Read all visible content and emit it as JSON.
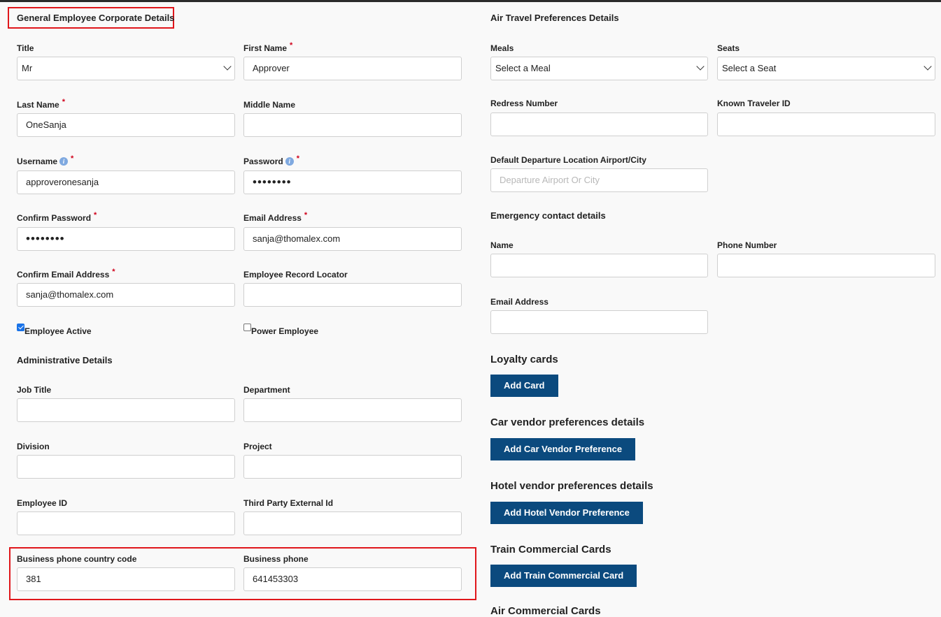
{
  "left": {
    "section_title": "General Employee Corporate Details",
    "title": {
      "label": "Title",
      "value": "Mr"
    },
    "first_name": {
      "label": "First Name",
      "value": "Approver"
    },
    "last_name": {
      "label": "Last Name",
      "value": "OneSanja"
    },
    "middle_name": {
      "label": "Middle Name",
      "value": ""
    },
    "username": {
      "label": "Username",
      "value": "approveronesanja"
    },
    "password": {
      "label": "Password",
      "value": "••••••••"
    },
    "confirm_password": {
      "label": "Confirm Password",
      "value": "••••••••"
    },
    "email": {
      "label": "Email Address",
      "value": "sanja@thomalex.com"
    },
    "confirm_email": {
      "label": "Confirm Email Address",
      "value": "sanja@thomalex.com"
    },
    "employee_record_locator": {
      "label": "Employee Record Locator",
      "value": ""
    },
    "employee_active": {
      "label": "Employee Active",
      "checked": true
    },
    "power_employee": {
      "label": "Power Employee",
      "checked": false
    },
    "admin_title": "Administrative Details",
    "job_title": {
      "label": "Job Title",
      "value": ""
    },
    "department": {
      "label": "Department",
      "value": ""
    },
    "division": {
      "label": "Division",
      "value": ""
    },
    "project": {
      "label": "Project",
      "value": ""
    },
    "employee_id": {
      "label": "Employee ID",
      "value": ""
    },
    "third_party_id": {
      "label": "Third Party External Id",
      "value": ""
    },
    "business_phone_cc": {
      "label": "Business phone country code",
      "value": "381"
    },
    "business_phone": {
      "label": "Business phone",
      "value": "641453303"
    },
    "required_mark": "*"
  },
  "right": {
    "section_title": "Air Travel Preferences Details",
    "meals": {
      "label": "Meals",
      "value": "Select a Meal"
    },
    "seats": {
      "label": "Seats",
      "value": "Select a Seat"
    },
    "redress": {
      "label": "Redress Number",
      "value": ""
    },
    "known_traveler": {
      "label": "Known Traveler ID",
      "value": ""
    },
    "departure": {
      "label": "Default Departure Location Airport/City",
      "placeholder": "Departure Airport Or City"
    },
    "emergency_title": "Emergency contact details",
    "em_name": {
      "label": "Name",
      "value": ""
    },
    "em_phone": {
      "label": "Phone Number",
      "value": ""
    },
    "em_email": {
      "label": "Email Address",
      "value": ""
    },
    "loyalty_title": "Loyalty cards",
    "loyalty_button": "Add Card",
    "car_title": "Car vendor preferences details",
    "car_button": "Add Car Vendor Preference",
    "hotel_title": "Hotel vendor preferences details",
    "hotel_button": "Add Hotel Vendor Preference",
    "train_title": "Train Commercial Cards",
    "train_button": "Add Train Commercial Card",
    "air_cards_title": "Air Commercial Cards"
  },
  "colors": {
    "button": "#0b4a7e",
    "highlight_box": "#e0161b",
    "required": "#d0021b",
    "info_icon": "#7fa9e0"
  },
  "icons": {
    "info": "info-icon",
    "select": "chevron-down-icon",
    "check": "checkbox-checked-icon"
  }
}
